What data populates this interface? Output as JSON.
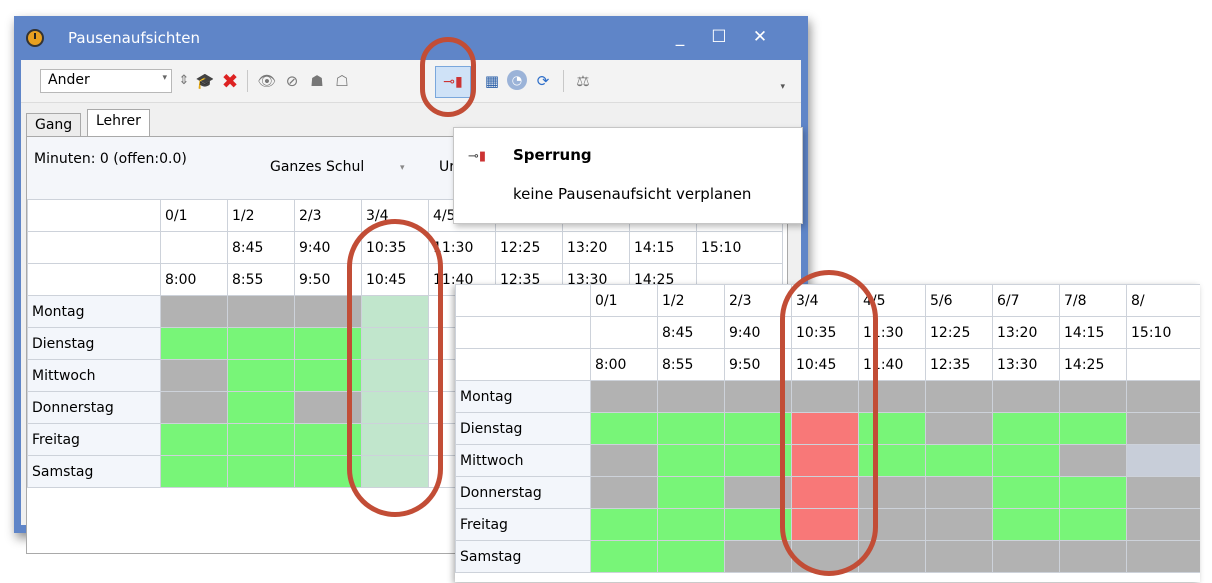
{
  "window": {
    "title": "Pausenaufsichten",
    "minimize": "_",
    "maximize": "☐",
    "close": "✕"
  },
  "toolbar": {
    "combo_value": "Ander",
    "combo_arrow": "▾",
    "more": "▾",
    "icons": [
      "sort-icon",
      "teacher-hat-icon",
      "delete-icon",
      "eye-icon",
      "eye-hidden-icon",
      "people-icon",
      "people-gray-icon",
      "lock-icon",
      "calculator-icon",
      "clock-icon",
      "refresh-icon",
      "balance-icon"
    ]
  },
  "tabs": [
    "Gang",
    "Lehrer"
  ],
  "info": {
    "minutes": "Minuten: 0 (offen:0.0)",
    "scope": "Ganzes Schul",
    "scope_arrow": "▾",
    "u_label": "Ur"
  },
  "tooltip": {
    "title": "Sperrung",
    "description": "keine Pausenaufsicht verplanen"
  },
  "grid": {
    "periods": [
      "0/1",
      "1/2",
      "2/3",
      "3/4",
      "4/5",
      "5/6",
      "6/7",
      "7/8",
      "8/"
    ],
    "start_times": [
      "",
      "8:45",
      "9:40",
      "10:35",
      "11:30",
      "12:25",
      "13:20",
      "14:15",
      "15:10"
    ],
    "end_times": [
      "8:00",
      "8:55",
      "9:50",
      "10:45",
      "11:40",
      "12:35",
      "13:30",
      "14:25",
      ""
    ],
    "days": [
      "Montag",
      "Dienstag",
      "Mittwoch",
      "Donnerstag",
      "Freitag",
      "Samstag"
    ]
  },
  "back_grid_cells": [
    [
      "g",
      "g",
      "g",
      "s"
    ],
    [
      "n",
      "n",
      "n",
      "s"
    ],
    [
      "g",
      "n",
      "n",
      "s"
    ],
    [
      "g",
      "n",
      "g",
      "s"
    ],
    [
      "n",
      "n",
      "n",
      "s"
    ],
    [
      "n",
      "n",
      "n",
      "s"
    ]
  ],
  "zoom_grid_cells": [
    [
      "g",
      "g",
      "g",
      "g",
      "g",
      "g",
      "g",
      "g",
      "g"
    ],
    [
      "n",
      "n",
      "n",
      "r",
      "n",
      "g",
      "n",
      "n",
      "g"
    ],
    [
      "g",
      "n",
      "n",
      "r",
      "n",
      "n",
      "n",
      "g",
      "l"
    ],
    [
      "g",
      "n",
      "g",
      "r",
      "g",
      "g",
      "n",
      "n",
      "g"
    ],
    [
      "n",
      "n",
      "n",
      "r",
      "g",
      "g",
      "n",
      "n",
      "g"
    ],
    [
      "n",
      "n",
      "g",
      "g",
      "g",
      "g",
      "g",
      "g",
      "g"
    ]
  ],
  "colors": {
    "available": "#78f578",
    "unavailable": "#b2b2b2",
    "blocked": "#f87878",
    "selected_column": "#c1e6cc",
    "highlight": "#c24d36",
    "titlebar": "#5f85c8"
  }
}
